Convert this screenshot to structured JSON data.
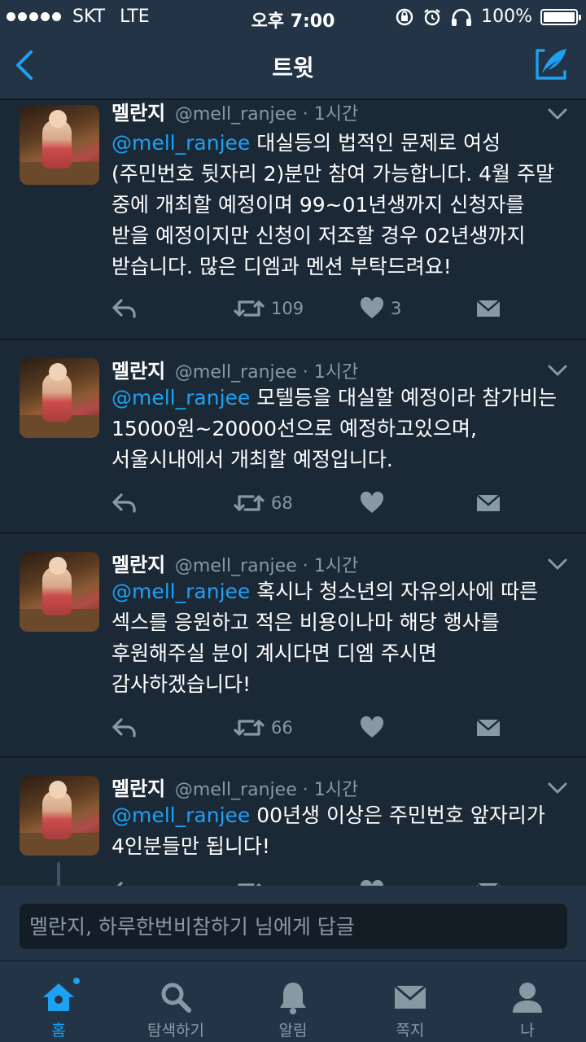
{
  "status_bar": {
    "carrier": "SKT",
    "network": "LTE",
    "time": "오후 7:00",
    "battery": "100%"
  },
  "nav": {
    "title": "트윗"
  },
  "tweets": [
    {
      "name": "멜란지",
      "handle": "@mell_ranjee · 1시간",
      "mention": "@mell_ranjee",
      "body": " 대실등의 법적인 문제로 여성(주민번호 뒷자리 2)분만 참여 가능합니다. 4월 주말 중에 개최할 예정이며 99~01년생까지 신청자를 받을 예정이지만 신청이 저조할 경우 02년생까지 받습니다. 많은 디엠과 멘션 부탁드려요!",
      "retweets": "109",
      "likes": "3"
    },
    {
      "name": "멜란지",
      "handle": "@mell_ranjee · 1시간",
      "mention": "@mell_ranjee",
      "body": " 모텔등을 대실할 예정이라 참가비는 15000원~20000선으로 예정하고있으며, 서울시내에서 개최할 예정입니다.",
      "retweets": "68",
      "likes": ""
    },
    {
      "name": "멜란지",
      "handle": "@mell_ranjee · 1시간",
      "mention": "@mell_ranjee",
      "body": " 혹시나 청소년의 자유의사에 따른 섹스를 응원하고 적은 비용이나마 해당 행사를 후원해주실 분이 계시다면 디엠 주시면 감사하겠습니다!",
      "retweets": "66",
      "likes": ""
    },
    {
      "name": "멜란지",
      "handle": "@mell_ranjee · 1시간",
      "mention": "@mell_ranjee",
      "body": " 00년생 이상은 주민번호 앞자리가 4인분들만 됩니다!",
      "retweets": "",
      "likes": ""
    }
  ],
  "reply": {
    "placeholder": "멜란지, 하루한번비참하기 님에게 답글"
  },
  "tabs": [
    {
      "label": "홈",
      "icon": "home-icon",
      "active": true
    },
    {
      "label": "탐색하기",
      "icon": "search-icon"
    },
    {
      "label": "알림",
      "icon": "bell-icon"
    },
    {
      "label": "쪽지",
      "icon": "envelope-icon"
    },
    {
      "label": "나",
      "icon": "person-icon"
    }
  ],
  "colors": {
    "background": "#141d26",
    "card": "#1b2836",
    "bar": "#243447",
    "accent": "#1da1f2",
    "muted": "#8899a6"
  }
}
